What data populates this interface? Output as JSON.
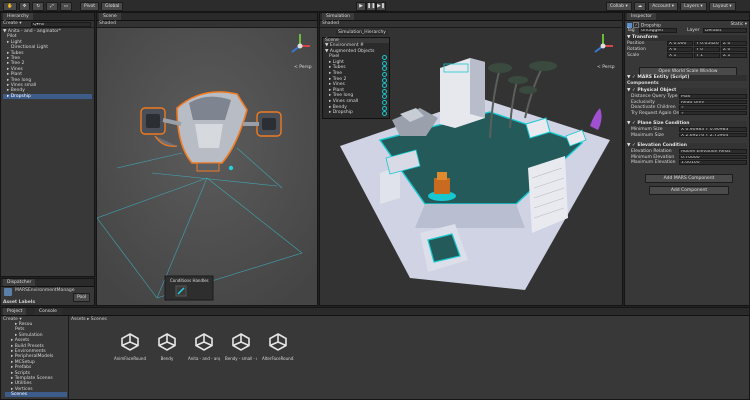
{
  "toolbar": {
    "pivot": "Pivot",
    "global": "Global",
    "play_icons": [
      "▶",
      "❚❚",
      "▶❚"
    ],
    "collab": "Collab ▾",
    "account": "Account ▾",
    "layers": "Layers ▾",
    "layout": "Layout ▾"
  },
  "hierarchy": {
    "tab": "Hierarchy",
    "create": "Create ▾",
    "search_placeholder": "Q▾All",
    "items": [
      {
        "label": "▼ Anita - and - anginator*",
        "indent": 0,
        "selected": false
      },
      {
        "label": "Pilot",
        "indent": 1,
        "selected": false
      },
      {
        "label": "▸ Light",
        "indent": 1,
        "selected": false
      },
      {
        "label": "Directional Light",
        "indent": 2,
        "selected": false
      },
      {
        "label": "▸ Tubes",
        "indent": 1,
        "selected": false
      },
      {
        "label": "▸ Tree",
        "indent": 1,
        "selected": false
      },
      {
        "label": "▸ Tree 2",
        "indent": 1,
        "selected": false
      },
      {
        "label": "▸ Vines",
        "indent": 1,
        "selected": false
      },
      {
        "label": "▸ Plant",
        "indent": 1,
        "selected": false
      },
      {
        "label": "▸ Tree long",
        "indent": 1,
        "selected": false
      },
      {
        "label": "▸ Vines small",
        "indent": 1,
        "selected": false
      },
      {
        "label": "▸ Bendy",
        "indent": 1,
        "selected": false
      },
      {
        "label": "▸ Dropship",
        "indent": 1,
        "selected": true
      }
    ]
  },
  "scene": {
    "tab": "Scene",
    "shaded": "Shaded",
    "persp": "< Persp",
    "overlay_title": "Conditions Handles"
  },
  "simulation": {
    "tab": "Simulation",
    "shaded": "Shaded",
    "title": "Simulation_Hierarchy",
    "persp": "< Persp",
    "sim_tree_header": "Scene",
    "sim_tree": [
      "▼ Environment #",
      "▼ Augmented Objects",
      "Pixel",
      "▸ Light",
      "▸ Tubes",
      "▸ Tree",
      "▸ Tree 2",
      "▸ Vines",
      "▸ Plant",
      "▸ Tree long",
      "▸ Vines small",
      "▸ Bendy",
      "▸ Dropship"
    ]
  },
  "inspector": {
    "tab": "Inspector",
    "name": "Dropship",
    "static": "Static ▾",
    "tag_label": "Tag",
    "tag_value": "Untagged",
    "layer_label": "Layer",
    "layer_value": "Default",
    "transform": "Transform",
    "position": {
      "label": "Position",
      "x": "X 0.000",
      "y": "Y 0.054203",
      "z": "Z 0"
    },
    "rotation": {
      "label": "Rotation",
      "x": "X 0",
      "y": "Y 0",
      "z": "Z 0"
    },
    "scale": {
      "label": "Scale",
      "x": "X 1",
      "y": "Y 1",
      "z": "Z 1"
    },
    "open_btn": "Open World Scale Window",
    "script_header": "MARS Entity (Script)",
    "components": "Components",
    "physical_object": "Physical Object",
    "po_rows": [
      {
        "label": "Distance Query Type",
        "value": "Max"
      },
      {
        "label": "Exclusivity",
        "value": "Read Only"
      },
      {
        "label": "Deactivate Children",
        "value": "✓"
      },
      {
        "label": "Try Request Again On...",
        "value": "✓"
      }
    ],
    "plane_size": "Plane Size Condition",
    "ps_rows": [
      {
        "label": "Minimum Size",
        "value": "X 0.90983  Y 0.90983"
      },
      {
        "label": "Maximum Size",
        "value": "X 2.69276  Y 2.75904"
      }
    ],
    "elevation": "Elevation Condition",
    "el_rows": [
      {
        "label": "Elevation Relation",
        "value": "Above Elevation Relat"
      },
      {
        "label": "Minimum Elevation",
        "value": "0.70000"
      },
      {
        "label": "Maximum Elevation",
        "value": "1.00100"
      }
    ],
    "add_mars": "Add MARS Component",
    "add_component": "Add Component"
  },
  "dispatcher": {
    "tab": "Dispatcher",
    "line1": "MARSEnvironmentManage",
    "line2": "Pool",
    "assets_label": "Asset Labels"
  },
  "project": {
    "tab": "Project",
    "console_tab": "Console",
    "create": "Create ▾",
    "breadcrumb": "Assets ▸ Scenes",
    "tree": [
      "▸ Resou",
      "Pets",
      "▸ Simulation",
      "▸ Assets",
      "▸ Build Presets",
      "▸ Environments",
      "▸ PeripheralModels",
      "▸ MCSetup",
      "▸ Prefabs",
      "▸ Scripts",
      "▸ Template Scenes",
      "▸ Utilities",
      "▸ Vertices",
      "Scenes"
    ],
    "assets": [
      "AnimFaceRound2...",
      "Bendy",
      "Anita - and - ang...",
      "Bendy - small - ro...",
      "AlterFaceRound3..."
    ]
  },
  "colors": {
    "accent": "#18c8d0",
    "floor": "#2f6a6a",
    "selected": "#3d5c8a",
    "highlight": "#f07a20"
  }
}
